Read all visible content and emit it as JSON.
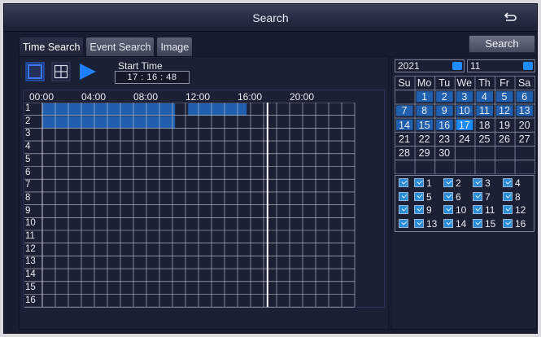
{
  "title": "Search",
  "tabs": [
    {
      "label": "Time Search",
      "active": true
    },
    {
      "label": "Event Search",
      "active": false
    },
    {
      "label": "Image",
      "active": false
    }
  ],
  "search_button": "Search",
  "start_time": {
    "label": "Start Time",
    "value": "17  :  16  :  48"
  },
  "timeline": {
    "hour_labels": [
      "00:00",
      "04:00",
      "08:00",
      "12:00",
      "16:00",
      "20:00"
    ],
    "channels": [
      "1",
      "2",
      "3",
      "4",
      "5",
      "6",
      "7",
      "8",
      "9",
      "10",
      "11",
      "12",
      "13",
      "14",
      "15",
      "16"
    ],
    "recordings": [
      {
        "channel": "1",
        "start_hour": 0,
        "end_hour": 10.2
      },
      {
        "channel": "1",
        "start_hour": 11.2,
        "end_hour": 15.7
      },
      {
        "channel": "2",
        "start_hour": 0,
        "end_hour": 10.2
      }
    ],
    "cursor_hour": 17.3
  },
  "calendar": {
    "year": "2021",
    "month": "11",
    "weekdays": [
      "Su",
      "Mo",
      "Tu",
      "We",
      "Th",
      "Fr",
      "Sa"
    ],
    "weeks": [
      [
        "",
        "1",
        "2",
        "3",
        "4",
        "5",
        "6"
      ],
      [
        "7",
        "8",
        "9",
        "10",
        "11",
        "12",
        "13"
      ],
      [
        "14",
        "15",
        "16",
        "17",
        "18",
        "19",
        "20"
      ],
      [
        "21",
        "22",
        "23",
        "24",
        "25",
        "26",
        "27"
      ],
      [
        "28",
        "29",
        "30",
        "",
        "",
        "",
        ""
      ],
      [
        "",
        "",
        "",
        "",
        "",
        "",
        ""
      ]
    ],
    "recorded_days": [
      "1",
      "2",
      "3",
      "4",
      "5",
      "6",
      "7",
      "8",
      "9",
      "10",
      "11",
      "12",
      "13",
      "14",
      "15",
      "16"
    ],
    "selected_day": "17"
  },
  "channel_checkboxes": {
    "rows": [
      [
        "",
        "1",
        "2",
        "3",
        "4"
      ],
      [
        "",
        "5",
        "6",
        "7",
        "8"
      ],
      [
        "",
        "9",
        "10",
        "11",
        "12"
      ],
      [
        "",
        "13",
        "14",
        "15",
        "16"
      ]
    ]
  },
  "colors": {
    "recording": "#1f5fae",
    "recorded_day": "#1f5fae",
    "selected_day": "#1a8cff",
    "accent": "#1f8dff"
  }
}
